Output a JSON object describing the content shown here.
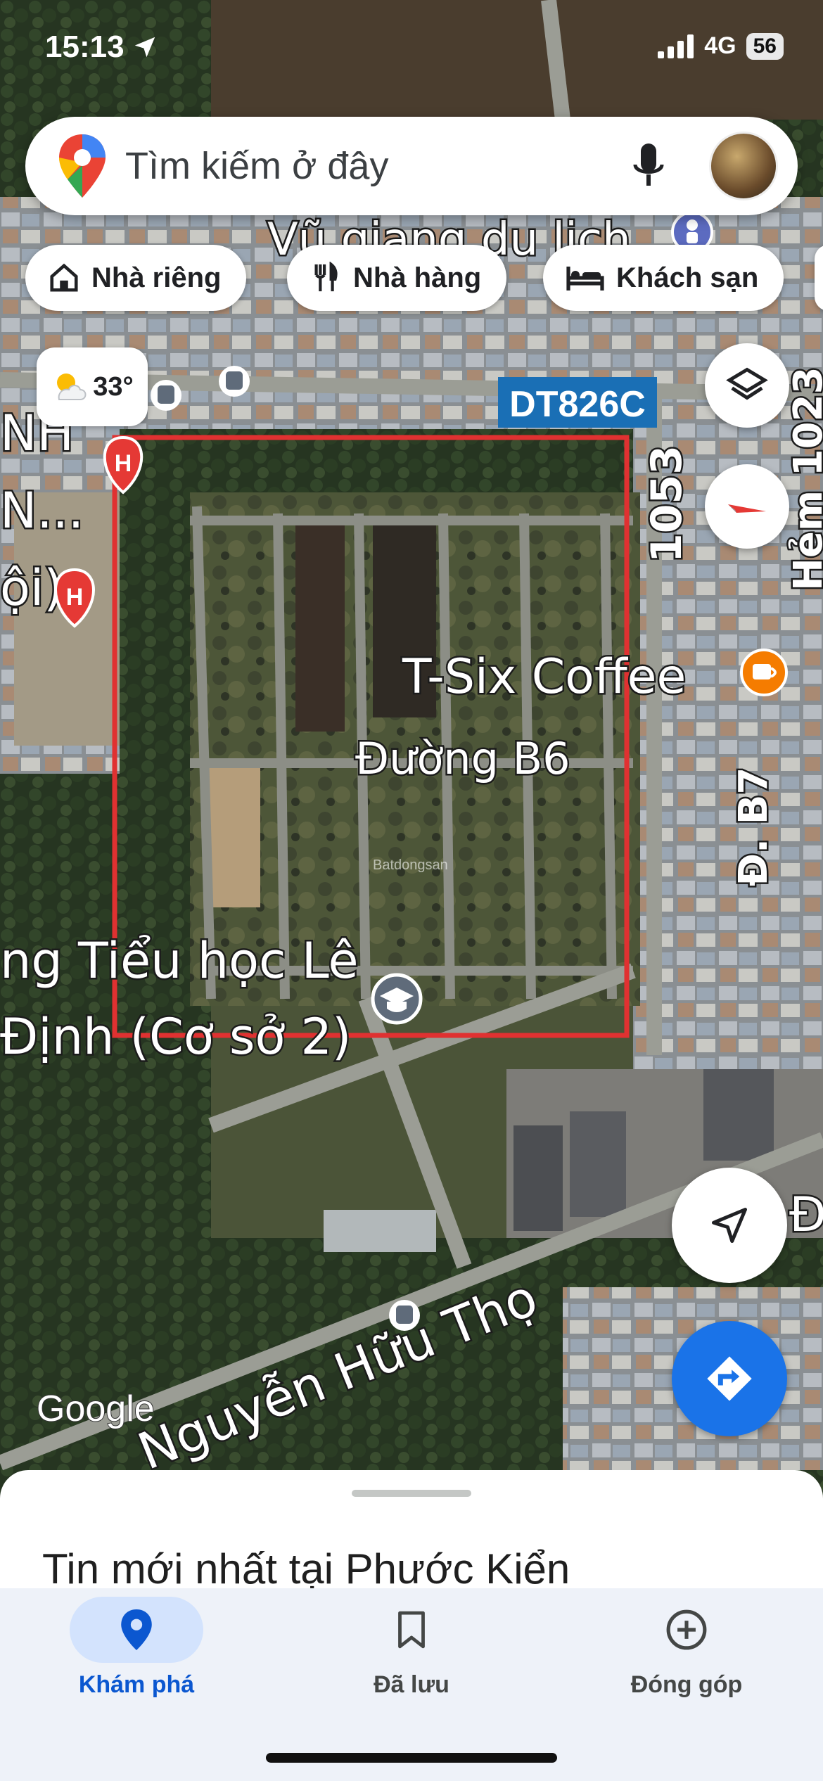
{
  "status_bar": {
    "time": "15:13",
    "network": "4G",
    "battery": "56"
  },
  "search": {
    "placeholder": "Tìm kiếm ở đây"
  },
  "chips": [
    {
      "label": "Nhà riêng",
      "icon": "home-icon"
    },
    {
      "label": "Nhà hàng",
      "icon": "restaurant-icon"
    },
    {
      "label": "Khách sạn",
      "icon": "hotel-icon"
    }
  ],
  "weather": {
    "temperature": "33°",
    "icon": "partly-cloudy-icon"
  },
  "map": {
    "road_badge": "DT826C",
    "labels": {
      "top_place": "Vũ giang du lịch",
      "road_1053": "1053",
      "hem": "Hẻm 1023",
      "coffee": "T-Six Coffee",
      "street_b6": "Đường B6",
      "street_b7": "Đ. B7",
      "school_line1": "ng Tiểu học Lê",
      "school_line2": "Định (Cơ sở 2)",
      "left_partial_1": "NH",
      "left_partial_2": "N...",
      "left_partial_3": "ội)",
      "nguyen_huu_tho": "Nguyễn Hữu Thọ",
      "right_edge": "Đ",
      "google": "Google",
      "watermark": "Batdongsan"
    },
    "highlight_color": "#e03131"
  },
  "sheet": {
    "title": "Tin mới nhất tại Phước Kiển"
  },
  "bottom_nav": {
    "items": [
      {
        "label": "Khám phá",
        "active": true
      },
      {
        "label": "Đã lưu",
        "active": false
      },
      {
        "label": "Đóng góp",
        "active": false
      }
    ]
  },
  "colors": {
    "accent": "#1a73e8",
    "active_pill": "#d3e3fd",
    "nav_active_text": "#0b57d0"
  }
}
